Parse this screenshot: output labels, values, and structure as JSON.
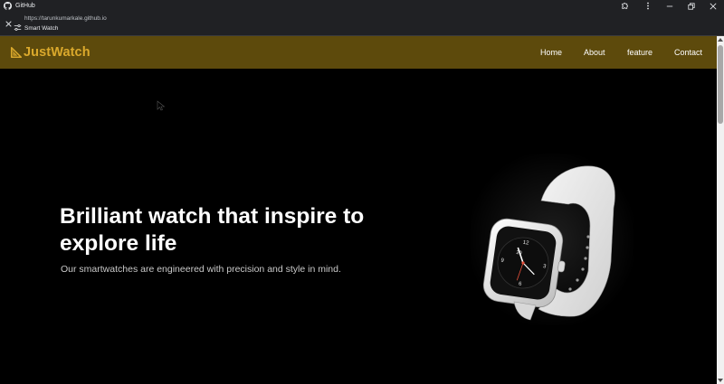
{
  "browser": {
    "window_title": "GitHub",
    "url": "https://tarunkumarkale.github.io",
    "page_title": "Smart Watch"
  },
  "site": {
    "brand": "JustWatch",
    "nav": [
      "Home",
      "About",
      "feature",
      "Contact"
    ],
    "hero": {
      "title": "Brilliant watch that inspire to explore life",
      "subtitle": "Our smartwatches are engineered with precision and style in mind."
    },
    "watch_face": {
      "hour_12": "12",
      "hour_3": "3",
      "hour_6": "6",
      "hour_9": "9",
      "date": "20"
    }
  },
  "colors": {
    "navbar_bg": "#5d4a0c",
    "brand": "#dba92c",
    "page_bg": "#000000",
    "hero_text": "#ffffff",
    "subtitle_text": "#c9c9c9"
  },
  "icons": {
    "github": "github-icon",
    "extensions": "puzzle-icon",
    "menu": "kebab-menu-icon",
    "close": "close-icon",
    "site_info": "tune-icon",
    "brand": "drafting-triangle-icon"
  }
}
